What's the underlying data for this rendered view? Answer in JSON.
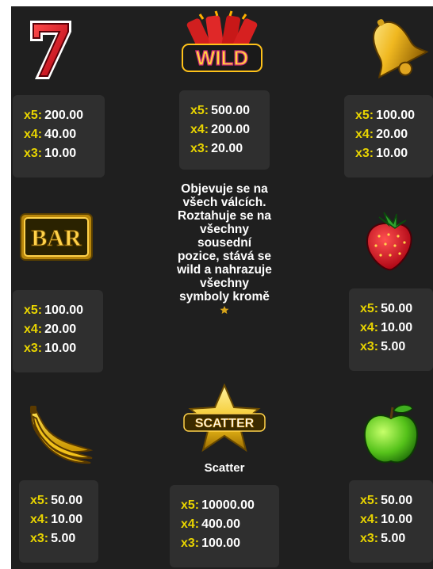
{
  "symbols": {
    "seven": {
      "name": "seven",
      "pays": [
        {
          "mult": "x5:",
          "value": "200.00"
        },
        {
          "mult": "x4:",
          "value": "40.00"
        },
        {
          "mult": "x3:",
          "value": "10.00"
        }
      ]
    },
    "wild": {
      "name": "wild",
      "logo_text": "WILD",
      "pays": [
        {
          "mult": "x5:",
          "value": "500.00"
        },
        {
          "mult": "x4:",
          "value": "200.00"
        },
        {
          "mult": "x3:",
          "value": "20.00"
        }
      ],
      "description": "Objevuje se na všech válcích. Roztahuje se na všechny sousední pozice, stává se wild a nahrazuje všechny symboly kromě",
      "description_icon": "small-star-icon"
    },
    "bell": {
      "name": "bell",
      "pays": [
        {
          "mult": "x5:",
          "value": "100.00"
        },
        {
          "mult": "x4:",
          "value": "20.00"
        },
        {
          "mult": "x3:",
          "value": "10.00"
        }
      ]
    },
    "bar": {
      "name": "bar",
      "logo_text": "BAR",
      "pays": [
        {
          "mult": "x5:",
          "value": "100.00"
        },
        {
          "mult": "x4:",
          "value": "20.00"
        },
        {
          "mult": "x3:",
          "value": "10.00"
        }
      ]
    },
    "strawberry": {
      "name": "strawberry",
      "pays": [
        {
          "mult": "x5:",
          "value": "50.00"
        },
        {
          "mult": "x4:",
          "value": "10.00"
        },
        {
          "mult": "x3:",
          "value": "5.00"
        }
      ]
    },
    "banana": {
      "name": "banana",
      "pays": [
        {
          "mult": "x5:",
          "value": "50.00"
        },
        {
          "mult": "x4:",
          "value": "10.00"
        },
        {
          "mult": "x3:",
          "value": "5.00"
        }
      ]
    },
    "scatter": {
      "name": "scatter",
      "logo_text": "SCATTER",
      "label": "Scatter",
      "pays": [
        {
          "mult": "x5:",
          "value": "10000.00"
        },
        {
          "mult": "x4:",
          "value": "400.00"
        },
        {
          "mult": "x3:",
          "value": "100.00"
        }
      ]
    },
    "apple": {
      "name": "apple",
      "pays": [
        {
          "mult": "x5:",
          "value": "50.00"
        },
        {
          "mult": "x4:",
          "value": "10.00"
        },
        {
          "mult": "x3:",
          "value": "5.00"
        }
      ]
    }
  },
  "colors": {
    "background": "#1f1f1f",
    "card": "#2f2f2f",
    "multiplier": "#e8d400",
    "value": "#ffffff"
  }
}
